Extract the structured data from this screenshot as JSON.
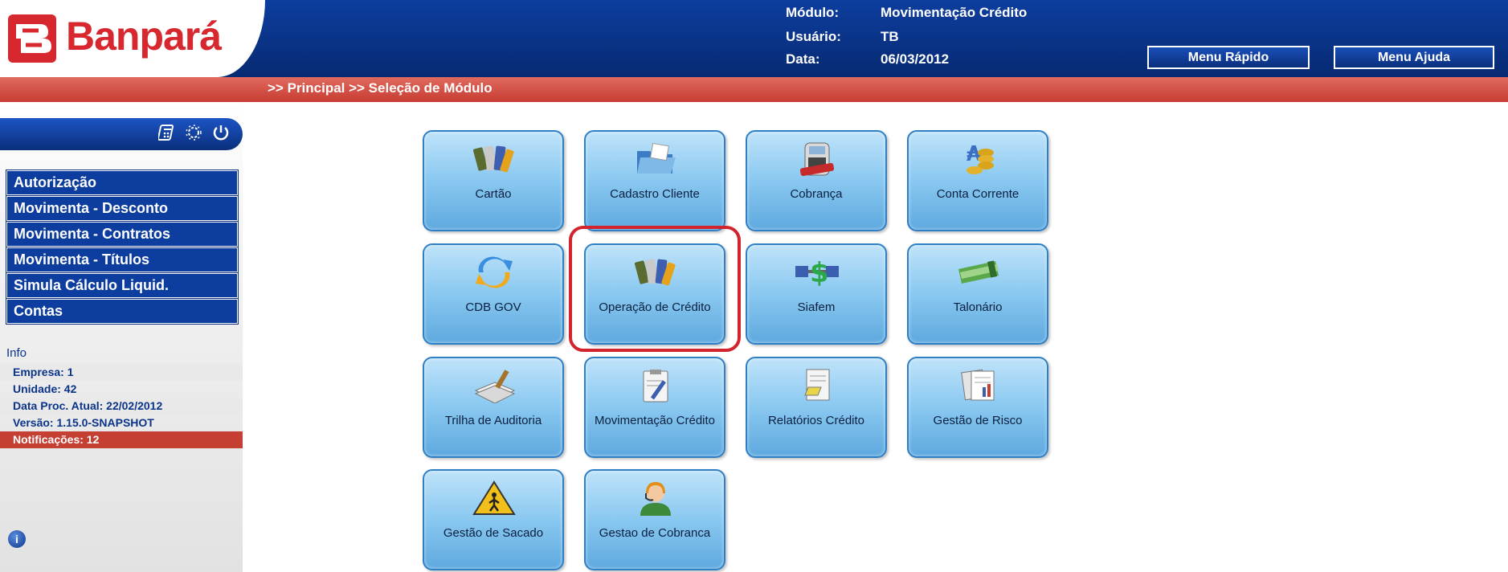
{
  "header": {
    "logo_text": "Banpará",
    "modulo_label": "Módulo:",
    "modulo_value": "Movimentação Crédito",
    "usuario_label": "Usuário:",
    "usuario_value": "TB",
    "data_label": "Data:",
    "data_value": "06/03/2012",
    "menu_rapido": "Menu Rápido",
    "menu_ajuda": "Menu Ajuda"
  },
  "breadcrumb": ">> Principal >> Seleção de Módulo",
  "sidebar": {
    "tool_icons": [
      "calculator-icon",
      "settings-icon",
      "power-icon"
    ],
    "menu_items": [
      "Autorização",
      "Movimenta - Desconto",
      "Movimenta - Contratos",
      "Movimenta - Títulos",
      "Simula Cálculo Liquid.",
      "Contas"
    ],
    "info": {
      "title": "Info",
      "empresa": "Empresa: 1",
      "unidade": "Unidade: 42",
      "data_proc": "Data Proc. Atual: 22/02/2012",
      "versao": "Versão: 1.15.0-SNAPSHOT",
      "notificacoes": "Notificações: 12"
    }
  },
  "modules": [
    {
      "label": "Cartão",
      "icon": "cards-icon"
    },
    {
      "label": "Cadastro Cliente",
      "icon": "folder-icon"
    },
    {
      "label": "Cobrança",
      "icon": "card-machine-icon"
    },
    {
      "label": "Conta Corrente",
      "icon": "coins-icon"
    },
    {
      "label": "CDB GOV",
      "icon": "sync-arrows-icon"
    },
    {
      "label": "Operação de Crédito",
      "icon": "cards-icon"
    },
    {
      "label": "Siafem",
      "icon": "network-money-icon"
    },
    {
      "label": "Talonário",
      "icon": "checkbook-icon"
    },
    {
      "label": "Trilha de Auditoria",
      "icon": "document-stack-icon"
    },
    {
      "label": "Movimentação Crédito",
      "icon": "clipboard-edit-icon"
    },
    {
      "label": "Relatórios Crédito",
      "icon": "report-icon"
    },
    {
      "label": "Gestão de Risco",
      "icon": "spreadsheet-icon"
    },
    {
      "label": "Gestão de Sacado",
      "icon": "warning-sign-icon"
    },
    {
      "label": "Gestao de Cobranca",
      "icon": "call-center-icon"
    }
  ],
  "colors": {
    "header_blue": "#0a3489",
    "breadcrumb_red": "#c73c33",
    "brand_red": "#d7282f",
    "tile_border": "#2e7fc6",
    "highlight": "#d3232d"
  }
}
